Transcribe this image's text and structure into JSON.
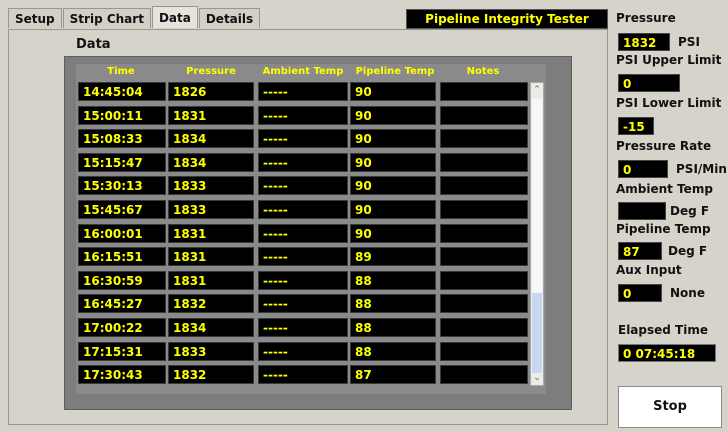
{
  "tabs": [
    {
      "label": "Setup"
    },
    {
      "label": "Strip Chart"
    },
    {
      "label": "Data"
    },
    {
      "label": "Details"
    }
  ],
  "app_title": "Pipeline Integrity Tester",
  "panel_title": "Data",
  "columns": [
    "Time",
    "Pressure",
    "Ambient Temp",
    "Pipeline Temp",
    "Notes"
  ],
  "rows": [
    {
      "time": "14:45:04",
      "pressure": "1826",
      "ambient": "-----",
      "pipeline": "90",
      "notes": ""
    },
    {
      "time": "15:00:11",
      "pressure": "1831",
      "ambient": "-----",
      "pipeline": "90",
      "notes": ""
    },
    {
      "time": "15:08:33",
      "pressure": "1834",
      "ambient": "-----",
      "pipeline": "90",
      "notes": ""
    },
    {
      "time": "15:15:47",
      "pressure": "1834",
      "ambient": "-----",
      "pipeline": "90",
      "notes": ""
    },
    {
      "time": "15:30:13",
      "pressure": "1833",
      "ambient": "-----",
      "pipeline": "90",
      "notes": ""
    },
    {
      "time": "15:45:67",
      "pressure": "1833",
      "ambient": "-----",
      "pipeline": "90",
      "notes": ""
    },
    {
      "time": "16:00:01",
      "pressure": "1831",
      "ambient": "-----",
      "pipeline": "90",
      "notes": ""
    },
    {
      "time": "16:15:51",
      "pressure": "1831",
      "ambient": "-----",
      "pipeline": "89",
      "notes": ""
    },
    {
      "time": "16:30:59",
      "pressure": "1831",
      "ambient": "-----",
      "pipeline": "88",
      "notes": ""
    },
    {
      "time": "16:45:27",
      "pressure": "1832",
      "ambient": "-----",
      "pipeline": "88",
      "notes": ""
    },
    {
      "time": "17:00:22",
      "pressure": "1834",
      "ambient": "-----",
      "pipeline": "88",
      "notes": ""
    },
    {
      "time": "17:15:31",
      "pressure": "1833",
      "ambient": "-----",
      "pipeline": "88",
      "notes": ""
    },
    {
      "time": "17:30:43",
      "pressure": "1832",
      "ambient": "-----",
      "pipeline": "87",
      "notes": ""
    }
  ],
  "side": {
    "pressure_label": "Pressure",
    "pressure_value": "1832",
    "pressure_unit": "PSI",
    "upper_label": "PSI Upper Limit",
    "upper_value": "0",
    "lower_label": "PSI Lower Limit",
    "lower_value": "-15",
    "rate_label": "Pressure Rate",
    "rate_value": "0",
    "rate_unit": "PSI/Min",
    "ambient_label": "Ambient Temp",
    "ambient_value": "",
    "ambient_unit": "Deg F",
    "pipeline_label": "Pipeline Temp",
    "pipeline_value": "87",
    "pipeline_unit": "Deg F",
    "aux_label": "Aux Input",
    "aux_value": "0",
    "aux_unit": "None",
    "elapsed_label": "Elapsed Time",
    "elapsed_value": "0  07:45:18",
    "stop_label": "Stop"
  },
  "colors": {
    "display_bg": "#000000",
    "display_text": "#ffff00",
    "panel_bg": "#d6d3cb"
  }
}
